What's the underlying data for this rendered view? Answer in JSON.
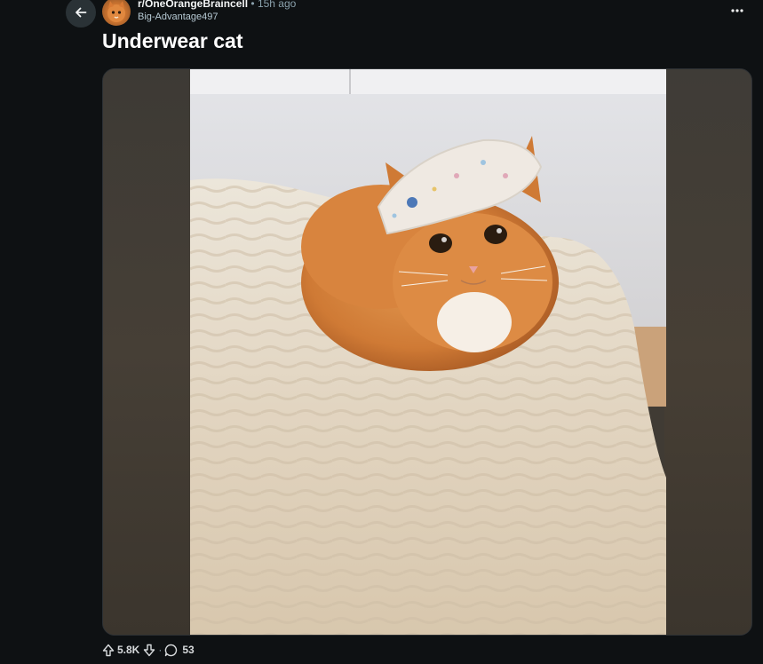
{
  "post": {
    "subreddit": "r/OneOrangeBraincell",
    "separator": "•",
    "time": "15h ago",
    "author": "Big-Advantage497",
    "title": "Underwear cat",
    "more_label": "···"
  },
  "icons": {
    "back": "back-arrow-icon",
    "avatar": "subreddit-avatar",
    "more": "more-options-icon",
    "upvote": "upvote-icon",
    "downvote": "downvote-icon",
    "comment": "comment-icon"
  },
  "actions": {
    "upvotes": "5.8K",
    "separator": "·",
    "comments": "53"
  },
  "colors": {
    "background": "#0e1113",
    "back_button": "#2a3236",
    "text": "#f2f4f5",
    "muted": "#8ba2ad"
  }
}
